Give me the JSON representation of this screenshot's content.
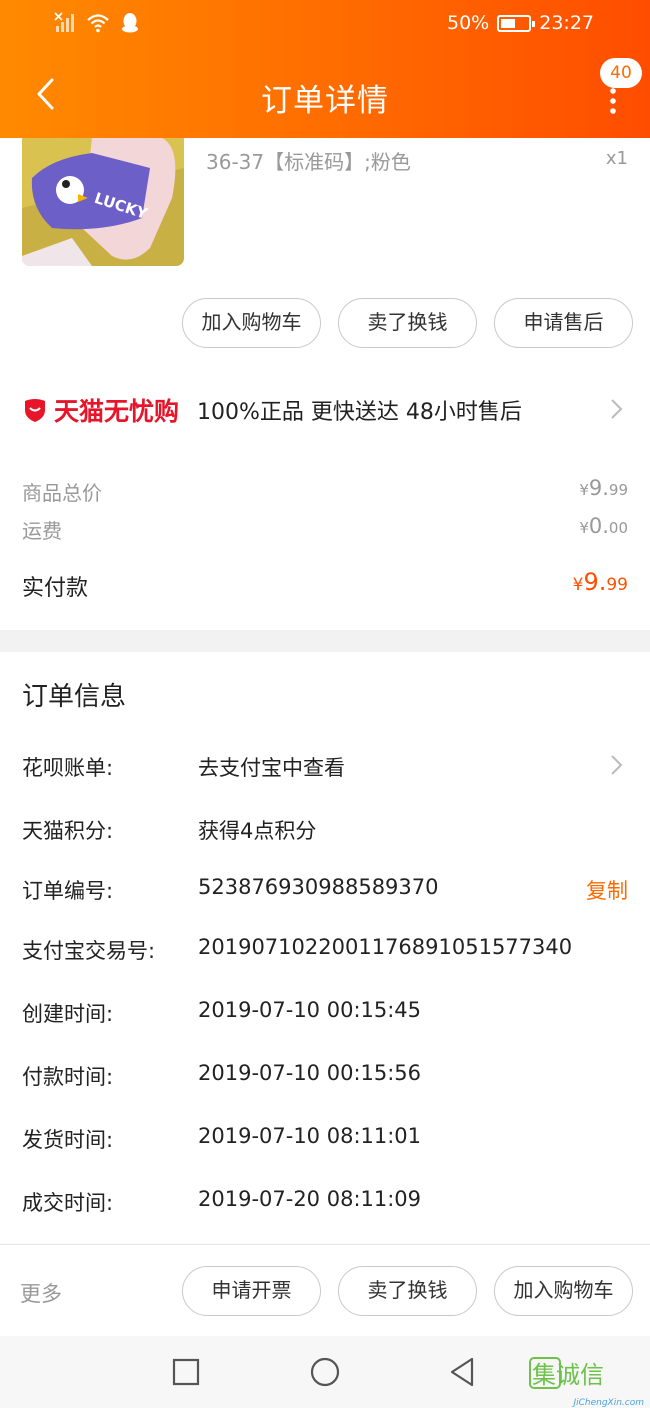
{
  "status_bar": {
    "battery_percent": "50%",
    "time": "23:27",
    "icons": [
      "no-sim-icon",
      "wifi-icon",
      "qq-icon"
    ]
  },
  "header": {
    "title": "订单详情",
    "badge_count": "40",
    "back_icon": "chevron-left-icon",
    "menu_icon": "more-vertical-icon"
  },
  "product": {
    "sku": "36-37【标准码】;粉色",
    "quantity": "x1",
    "image_text": "LUCKY",
    "actions": [
      "加入购物车",
      "卖了换钱",
      "申请售后"
    ]
  },
  "assurance": {
    "brand": "天猫无忧购",
    "text": "100%正品  更快送达  48小时售后"
  },
  "prices": {
    "goods_total_label": "商品总价",
    "goods_total_currency": "¥",
    "goods_total_int": "9.",
    "goods_total_dec": "99",
    "shipping_label": "运费",
    "shipping_currency": "¥",
    "shipping_int": "0.",
    "shipping_dec": "00",
    "paid_label": "实付款",
    "paid_currency": "¥",
    "paid_int": "9.",
    "paid_dec": "99"
  },
  "order_info": {
    "title": "订单信息",
    "rows": [
      {
        "label": "花呗账单:",
        "value": "去支付宝中查看"
      },
      {
        "label": "天猫积分:",
        "value": "获得4点积分"
      },
      {
        "label": "订单编号:",
        "value": "523876930988589370"
      },
      {
        "label": "支付宝交易号:",
        "value": "2019071022001176891051577340"
      },
      {
        "label": "创建时间:",
        "value": "2019-07-10 00:15:45"
      },
      {
        "label": "付款时间:",
        "value": "2019-07-10 00:15:56"
      },
      {
        "label": "发货时间:",
        "value": "2019-07-10 08:11:01"
      },
      {
        "label": "成交时间:",
        "value": "2019-07-20 08:11:09"
      }
    ],
    "copy_label": "复制"
  },
  "bottom_bar": {
    "more_label": "更多",
    "actions": [
      "申请开票",
      "卖了换钱",
      "加入购物车"
    ]
  },
  "watermark": {
    "logo_chars": "集诚信",
    "site": "JiChengXin.com"
  },
  "colors": {
    "header_start": "#ff8a00",
    "header_end": "#ff4d00",
    "accent": "#ff5000",
    "tmall_red": "#e8152a"
  }
}
